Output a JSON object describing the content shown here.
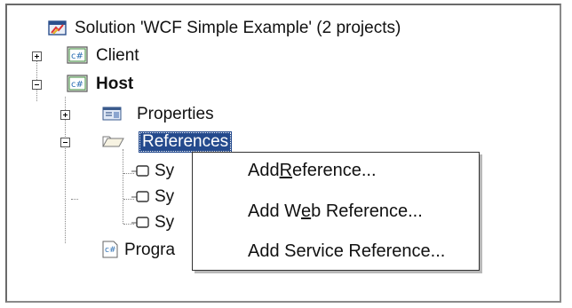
{
  "solution": {
    "label": "Solution 'WCF Simple Example' (2 projects)"
  },
  "projects": {
    "client": {
      "label": "Client"
    },
    "host": {
      "label": "Host"
    }
  },
  "host_children": {
    "properties": {
      "label": "Properties"
    },
    "references": {
      "label": "References"
    },
    "reference_items": [
      "Sy",
      "Sy",
      "Sy"
    ],
    "program": {
      "label": "Progra"
    }
  },
  "context_menu": {
    "add_reference": {
      "before": "Add ",
      "accel": "R",
      "after": "eference..."
    },
    "add_web_reference": {
      "before": "Add W",
      "accel": "e",
      "after": "b Reference..."
    },
    "add_service_reference": {
      "label": "Add Service Reference..."
    }
  },
  "icons": {
    "solution": "solution-icon",
    "project": "csharp-project-icon",
    "properties": "properties-icon",
    "references": "folder-icon",
    "reference_item": "assembly-reference-icon",
    "code_file": "csharp-file-icon"
  },
  "colors": {
    "selection": "#244a8d",
    "csharp_green": "#3e8e3e"
  }
}
